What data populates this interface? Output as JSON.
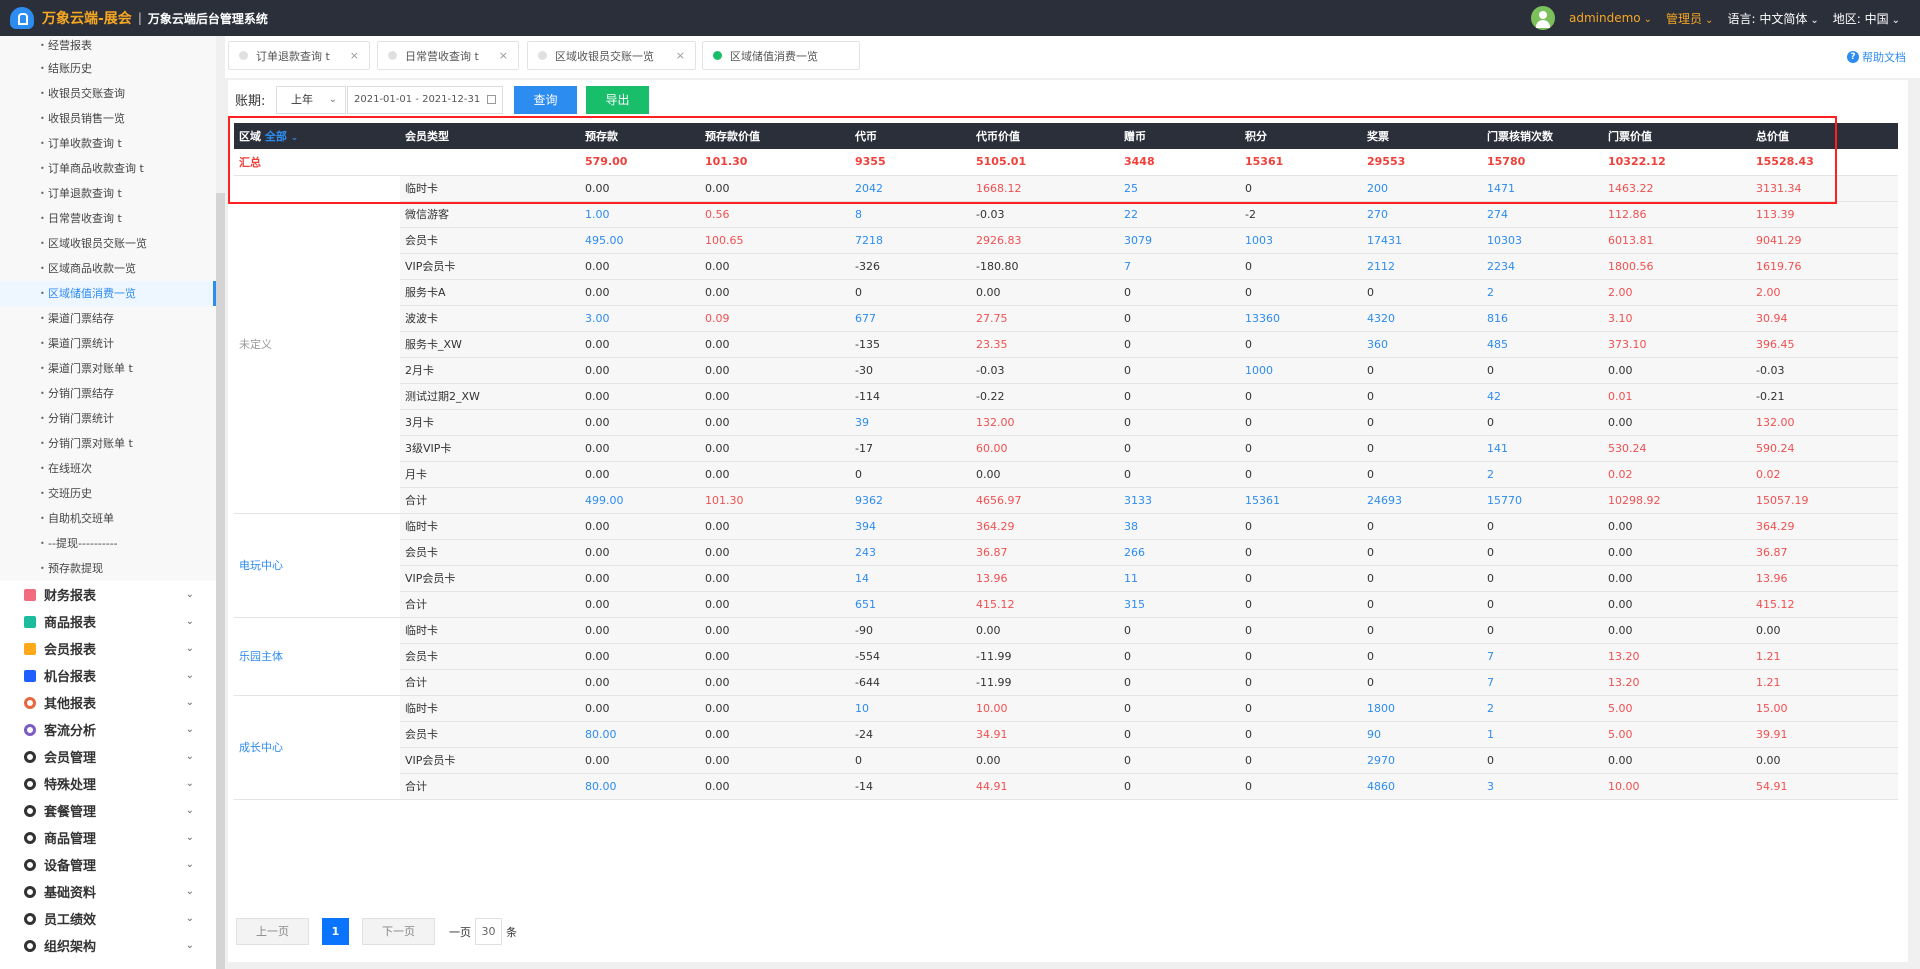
{
  "header": {
    "brand": "万象云端-展会",
    "separator": "|",
    "system": "万象云端后台管理系统",
    "user": "admindemo",
    "role": "管理员",
    "lang_label": "语言:",
    "lang": "中文简体",
    "region_label": "地区:",
    "region": "中国"
  },
  "sidebar": {
    "partial": "经营报表",
    "items": [
      "结账历史",
      "收银员交账查询",
      "收银员销售一览",
      "订单收款查询 t",
      "订单商品收款查询 t",
      "订单退款查询 t",
      "日常营收查询 t",
      "区域收银员交账一览",
      "区域商品收款一览",
      "区域储值消费一览",
      "渠道门票结存",
      "渠道门票统计",
      "渠道门票对账单 t",
      "分销门票结存",
      "分销门票统计",
      "分销门票对账单 t",
      "在线班次",
      "交班历史",
      "自助机交班单",
      "--提现----------",
      "预存款提现"
    ],
    "active_index": 9,
    "groups": [
      {
        "label": "财务报表",
        "icon": "book-icon",
        "color": "#f26b7f"
      },
      {
        "label": "商品报表",
        "icon": "book-icon",
        "color": "#1abc9c"
      },
      {
        "label": "会员报表",
        "icon": "book-icon",
        "color": "#ffa91a"
      },
      {
        "label": "机台报表",
        "icon": "book-icon",
        "color": "#1f5fff"
      },
      {
        "label": "其他报表",
        "icon": "layers-icon",
        "color": "#e8663d"
      },
      {
        "label": "客流分析",
        "icon": "target-icon",
        "color": "#7b5cc4"
      },
      {
        "label": "会员管理",
        "icon": "user-icon",
        "color": "#333"
      },
      {
        "label": "特殊处理",
        "icon": "warning-icon",
        "color": "#333"
      },
      {
        "label": "套餐管理",
        "icon": "edit-icon",
        "color": "#333"
      },
      {
        "label": "商品管理",
        "icon": "swap-icon",
        "color": "#333"
      },
      {
        "label": "设备管理",
        "icon": "branch-icon",
        "color": "#333"
      },
      {
        "label": "基础资料",
        "icon": "file-icon",
        "color": "#333"
      },
      {
        "label": "员工绩效",
        "icon": "gear-icon",
        "color": "#333"
      },
      {
        "label": "组织架构",
        "icon": "radio-icon",
        "color": "#333"
      }
    ]
  },
  "tabs": [
    {
      "label": "订单退款查询 t",
      "active": false
    },
    {
      "label": "日常营收查询 t",
      "active": false
    },
    {
      "label": "区域收银员交账一览",
      "active": false
    },
    {
      "label": "区域储值消费一览",
      "active": true
    }
  ],
  "help": "帮助文档",
  "toolbar": {
    "period_label": "账期:",
    "period_select": "上年",
    "date_range": "2021-01-01 - 2021-12-31",
    "query": "查询",
    "export": "导出"
  },
  "colors": {
    "blue": "#2d8cf0",
    "green": "#19be6b",
    "red": "#f05050",
    "header_bg": "#2b2f3a"
  },
  "table": {
    "region_header": "区域",
    "region_filter": "全部",
    "columns": [
      "会员类型",
      "预存款",
      "预存款价值",
      "代币",
      "代币价值",
      "赠币",
      "积分",
      "奖票",
      "门票核销次数",
      "门票价值",
      "总价值"
    ],
    "summary": {
      "label": "汇总",
      "values": [
        "579.00",
        "101.30",
        "9355",
        "5105.01",
        "3448",
        "15361",
        "29553",
        "15780",
        "10322.12",
        "15528.43"
      ]
    },
    "groups": [
      {
        "region": "未定义",
        "tone": "gray",
        "rows": [
          {
            "type": "临时卡",
            "v": [
              "0.00",
              "0.00",
              "2042",
              "1668.12",
              "25",
              "0",
              "200",
              "1471",
              "1463.22",
              "3131.34"
            ],
            "t": "kkbrbkbbrr"
          },
          {
            "type": "微信游客",
            "v": [
              "1.00",
              "0.56",
              "8",
              "-0.03",
              "22",
              "-2",
              "270",
              "274",
              "112.86",
              "113.39"
            ],
            "t": "brbkbkbbrr"
          },
          {
            "type": "会员卡",
            "v": [
              "495.00",
              "100.65",
              "7218",
              "2926.83",
              "3079",
              "1003",
              "17431",
              "10303",
              "6013.81",
              "9041.29"
            ],
            "t": "brbrbbbbrr"
          },
          {
            "type": "VIP会员卡",
            "v": [
              "0.00",
              "0.00",
              "-326",
              "-180.80",
              "7",
              "0",
              "2112",
              "2234",
              "1800.56",
              "1619.76"
            ],
            "t": "kkkkbkbbrr"
          },
          {
            "type": "服务卡A",
            "v": [
              "0.00",
              "0.00",
              "0",
              "0.00",
              "0",
              "0",
              "0",
              "2",
              "2.00",
              "2.00"
            ],
            "t": "kkkkkkkbrr"
          },
          {
            "type": "波波卡",
            "v": [
              "3.00",
              "0.09",
              "677",
              "27.75",
              "0",
              "13360",
              "4320",
              "816",
              "3.10",
              "30.94"
            ],
            "t": "brbrkbbbrr"
          },
          {
            "type": "服务卡_XW",
            "v": [
              "0.00",
              "0.00",
              "-135",
              "23.35",
              "0",
              "0",
              "360",
              "485",
              "373.10",
              "396.45"
            ],
            "t": "kkkrkkbbrr"
          },
          {
            "type": "2月卡",
            "v": [
              "0.00",
              "0.00",
              "-30",
              "-0.03",
              "0",
              "1000",
              "0",
              "0",
              "0.00",
              "-0.03"
            ],
            "t": "kkkkkbkkkk"
          },
          {
            "type": "测试过期2_XW",
            "v": [
              "0.00",
              "0.00",
              "-114",
              "-0.22",
              "0",
              "0",
              "0",
              "42",
              "0.01",
              "-0.21"
            ],
            "t": "kkkkkkkbrk"
          },
          {
            "type": "3月卡",
            "v": [
              "0.00",
              "0.00",
              "39",
              "132.00",
              "0",
              "0",
              "0",
              "0",
              "0.00",
              "132.00"
            ],
            "t": "kkbrkkkkkr"
          },
          {
            "type": "3级VIP卡",
            "v": [
              "0.00",
              "0.00",
              "-17",
              "60.00",
              "0",
              "0",
              "0",
              "141",
              "530.24",
              "590.24"
            ],
            "t": "kkkrkkkbrr"
          },
          {
            "type": "月卡",
            "v": [
              "0.00",
              "0.00",
              "0",
              "0.00",
              "0",
              "0",
              "0",
              "2",
              "0.02",
              "0.02"
            ],
            "t": "kkkkkkkbrr"
          },
          {
            "type": "合计",
            "v": [
              "499.00",
              "101.30",
              "9362",
              "4656.97",
              "3133",
              "15361",
              "24693",
              "15770",
              "10298.92",
              "15057.19"
            ],
            "t": "brbrbbbbrr"
          }
        ]
      },
      {
        "region": "电玩中心",
        "tone": "blue",
        "rows": [
          {
            "type": "临时卡",
            "v": [
              "0.00",
              "0.00",
              "394",
              "364.29",
              "38",
              "0",
              "0",
              "0",
              "0.00",
              "364.29"
            ],
            "t": "kkbrbkkkkr"
          },
          {
            "type": "会员卡",
            "v": [
              "0.00",
              "0.00",
              "243",
              "36.87",
              "266",
              "0",
              "0",
              "0",
              "0.00",
              "36.87"
            ],
            "t": "kkbrbkkkkr"
          },
          {
            "type": "VIP会员卡",
            "v": [
              "0.00",
              "0.00",
              "14",
              "13.96",
              "11",
              "0",
              "0",
              "0",
              "0.00",
              "13.96"
            ],
            "t": "kkbrbkkkkr"
          },
          {
            "type": "合计",
            "v": [
              "0.00",
              "0.00",
              "651",
              "415.12",
              "315",
              "0",
              "0",
              "0",
              "0.00",
              "415.12"
            ],
            "t": "kkbrbkkkkr"
          }
        ]
      },
      {
        "region": "乐园主体",
        "tone": "blue",
        "rows": [
          {
            "type": "临时卡",
            "v": [
              "0.00",
              "0.00",
              "-90",
              "0.00",
              "0",
              "0",
              "0",
              "0",
              "0.00",
              "0.00"
            ],
            "t": "kkkkkkkkkk"
          },
          {
            "type": "会员卡",
            "v": [
              "0.00",
              "0.00",
              "-554",
              "-11.99",
              "0",
              "0",
              "0",
              "7",
              "13.20",
              "1.21"
            ],
            "t": "kkkkkkkbrr"
          },
          {
            "type": "合计",
            "v": [
              "0.00",
              "0.00",
              "-644",
              "-11.99",
              "0",
              "0",
              "0",
              "7",
              "13.20",
              "1.21"
            ],
            "t": "kkkkkkkbrr"
          }
        ]
      },
      {
        "region": "成长中心",
        "tone": "blue",
        "rows": [
          {
            "type": "临时卡",
            "v": [
              "0.00",
              "0.00",
              "10",
              "10.00",
              "0",
              "0",
              "1800",
              "2",
              "5.00",
              "15.00"
            ],
            "t": "kkbrkkbbrr"
          },
          {
            "type": "会员卡",
            "v": [
              "80.00",
              "0.00",
              "-24",
              "34.91",
              "0",
              "0",
              "90",
              "1",
              "5.00",
              "39.91"
            ],
            "t": "bkkrkkbbrr"
          },
          {
            "type": "VIP会员卡",
            "v": [
              "0.00",
              "0.00",
              "0",
              "0.00",
              "0",
              "0",
              "2970",
              "0",
              "0.00",
              "0.00"
            ],
            "t": "kkkkkkbkkk"
          },
          {
            "type": "合计",
            "v": [
              "80.00",
              "0.00",
              "-14",
              "44.91",
              "0",
              "0",
              "4860",
              "3",
              "10.00",
              "54.91"
            ],
            "t": "bkkrkkbbrr"
          }
        ]
      }
    ]
  },
  "pager": {
    "prev": "上一页",
    "page": "1",
    "next": "下一页",
    "per_page_label": "一页",
    "per_page": "30",
    "unit": "条"
  }
}
